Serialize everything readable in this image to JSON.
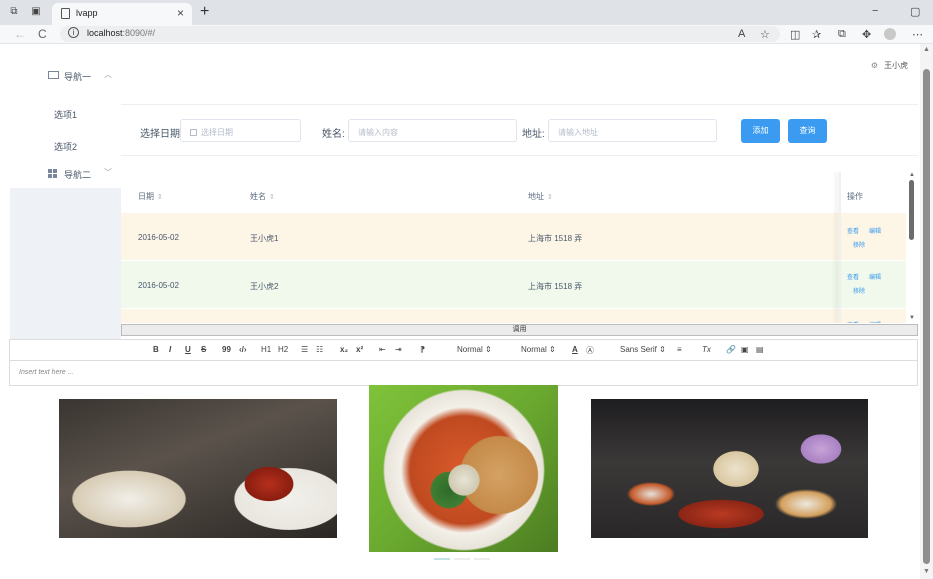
{
  "browser": {
    "tab_title": "lvapp",
    "tab_close": "×",
    "new_tab": "+",
    "url_host": "localhost",
    "url_rest": ":8090/#/",
    "back": "←",
    "reload": "C",
    "minimize": "−",
    "restore": "▢"
  },
  "sidebar": {
    "nav1_label": "导航一",
    "nav1_chevron": "︿",
    "option1": "选项1",
    "option2": "选项2",
    "nav2_label": "导航二",
    "nav2_chevron": "﹀"
  },
  "header": {
    "gear": "⚙",
    "user_name": "王小虎"
  },
  "form": {
    "date_label": "选择日期:",
    "date_placeholder": "选择日期",
    "name_label": "姓名:",
    "name_placeholder": "请输入内容",
    "address_label": "地址:",
    "address_placeholder": "请输入地址",
    "add_button": "添加",
    "query_button": "查询"
  },
  "table": {
    "columns": [
      "日期",
      "姓名",
      "地址",
      "操作"
    ],
    "sort_glyph": "⇕",
    "rows": [
      {
        "date": "2016-05-02",
        "name": "王小虎1",
        "address": "上海市 1518 弄",
        "bg": "#fdf5e6"
      },
      {
        "date": "2016-05-02",
        "name": "王小虎2",
        "address": "上海市 1518 弄",
        "bg": "#f0f9eb"
      },
      {
        "date": "",
        "name": "",
        "address": "",
        "bg": "#fdf5e6"
      }
    ],
    "actions": {
      "view": "查看",
      "edit": "编辑",
      "remove": "移除"
    }
  },
  "resizer": {
    "label": "调用"
  },
  "editor": {
    "tools": [
      "B",
      "I",
      "U",
      "S",
      "99",
      "‹/›",
      "H1",
      "H2",
      "☰",
      "☷",
      "x₂",
      "x²",
      "⇤",
      "⇥",
      "⁋"
    ],
    "header_select": "Normal ⇕",
    "size_select": "Normal ⇕",
    "font_select": "Sans Serif ⇕",
    "extra_tools": [
      "A",
      "Ⓐ",
      "≡",
      "Tx",
      "🔗",
      "▣",
      "▤"
    ],
    "placeholder": "Insert text here ..."
  },
  "carousel": {
    "images": [
      "crawfish-plate-photo",
      "noodle-soup-photo",
      "seafood-table-photo"
    ],
    "active_index": 0
  },
  "colors": {
    "primary": "#3a9bf0",
    "row_warning": "#fdf5e6",
    "row_success": "#f0f9eb",
    "sidebar_bg": "#eef1f6"
  }
}
